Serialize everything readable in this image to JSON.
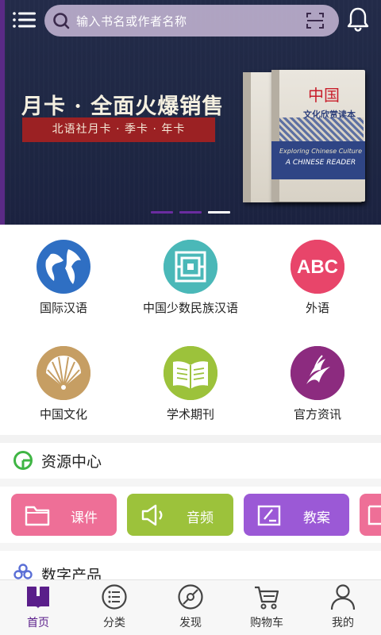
{
  "search": {
    "placeholder": "输入书名或作者名称"
  },
  "banner": {
    "title": "月卡 · 全面火爆销售",
    "subtitle": "北语社月卡 · 季卡 · 年卡",
    "book_title_cn": "中国",
    "book_subtitle_cn": "文化欣赏读本",
    "book_title_en_1": "Exploring Chinese Culture",
    "book_title_en_2": "A CHINESE READER",
    "carousel_index": 3,
    "carousel_total": 3
  },
  "categories": [
    {
      "label": "国际汉语",
      "color": "#2f6fc3",
      "icon": "globe-icon"
    },
    {
      "label": "中国少数民族汉语",
      "color": "#4ab8b8",
      "icon": "pattern-icon"
    },
    {
      "label": "外语",
      "color": "#e8456a",
      "icon": "abc-icon"
    },
    {
      "label": "中国文化",
      "color": "#c69e63",
      "icon": "fan-icon"
    },
    {
      "label": "学术期刊",
      "color": "#9cc23b",
      "icon": "book-icon"
    },
    {
      "label": "官方资讯",
      "color": "#8c2b7f",
      "icon": "phoenix-icon"
    }
  ],
  "resource_center": {
    "title": "资源中心",
    "buttons": [
      {
        "label": "课件",
        "color": "#ee6f97",
        "icon": "folder-icon"
      },
      {
        "label": "音频",
        "color": "#9cc23b",
        "icon": "speaker-icon"
      },
      {
        "label": "教案",
        "color": "#9b59d6",
        "icon": "edit-icon"
      }
    ]
  },
  "digital_products": {
    "title": "数字产品"
  },
  "tabbar": {
    "tabs": [
      {
        "label": "首页",
        "active": true,
        "icon": "home-book-icon"
      },
      {
        "label": "分类",
        "active": false,
        "icon": "list-icon"
      },
      {
        "label": "发现",
        "active": false,
        "icon": "compass-icon"
      },
      {
        "label": "购物车",
        "active": false,
        "icon": "cart-icon"
      },
      {
        "label": "我的",
        "active": false,
        "icon": "user-icon"
      }
    ]
  },
  "colors": {
    "brand": "#5a1e8a",
    "banner_bg": "#1e2743",
    "promo_red": "#9b2123"
  }
}
